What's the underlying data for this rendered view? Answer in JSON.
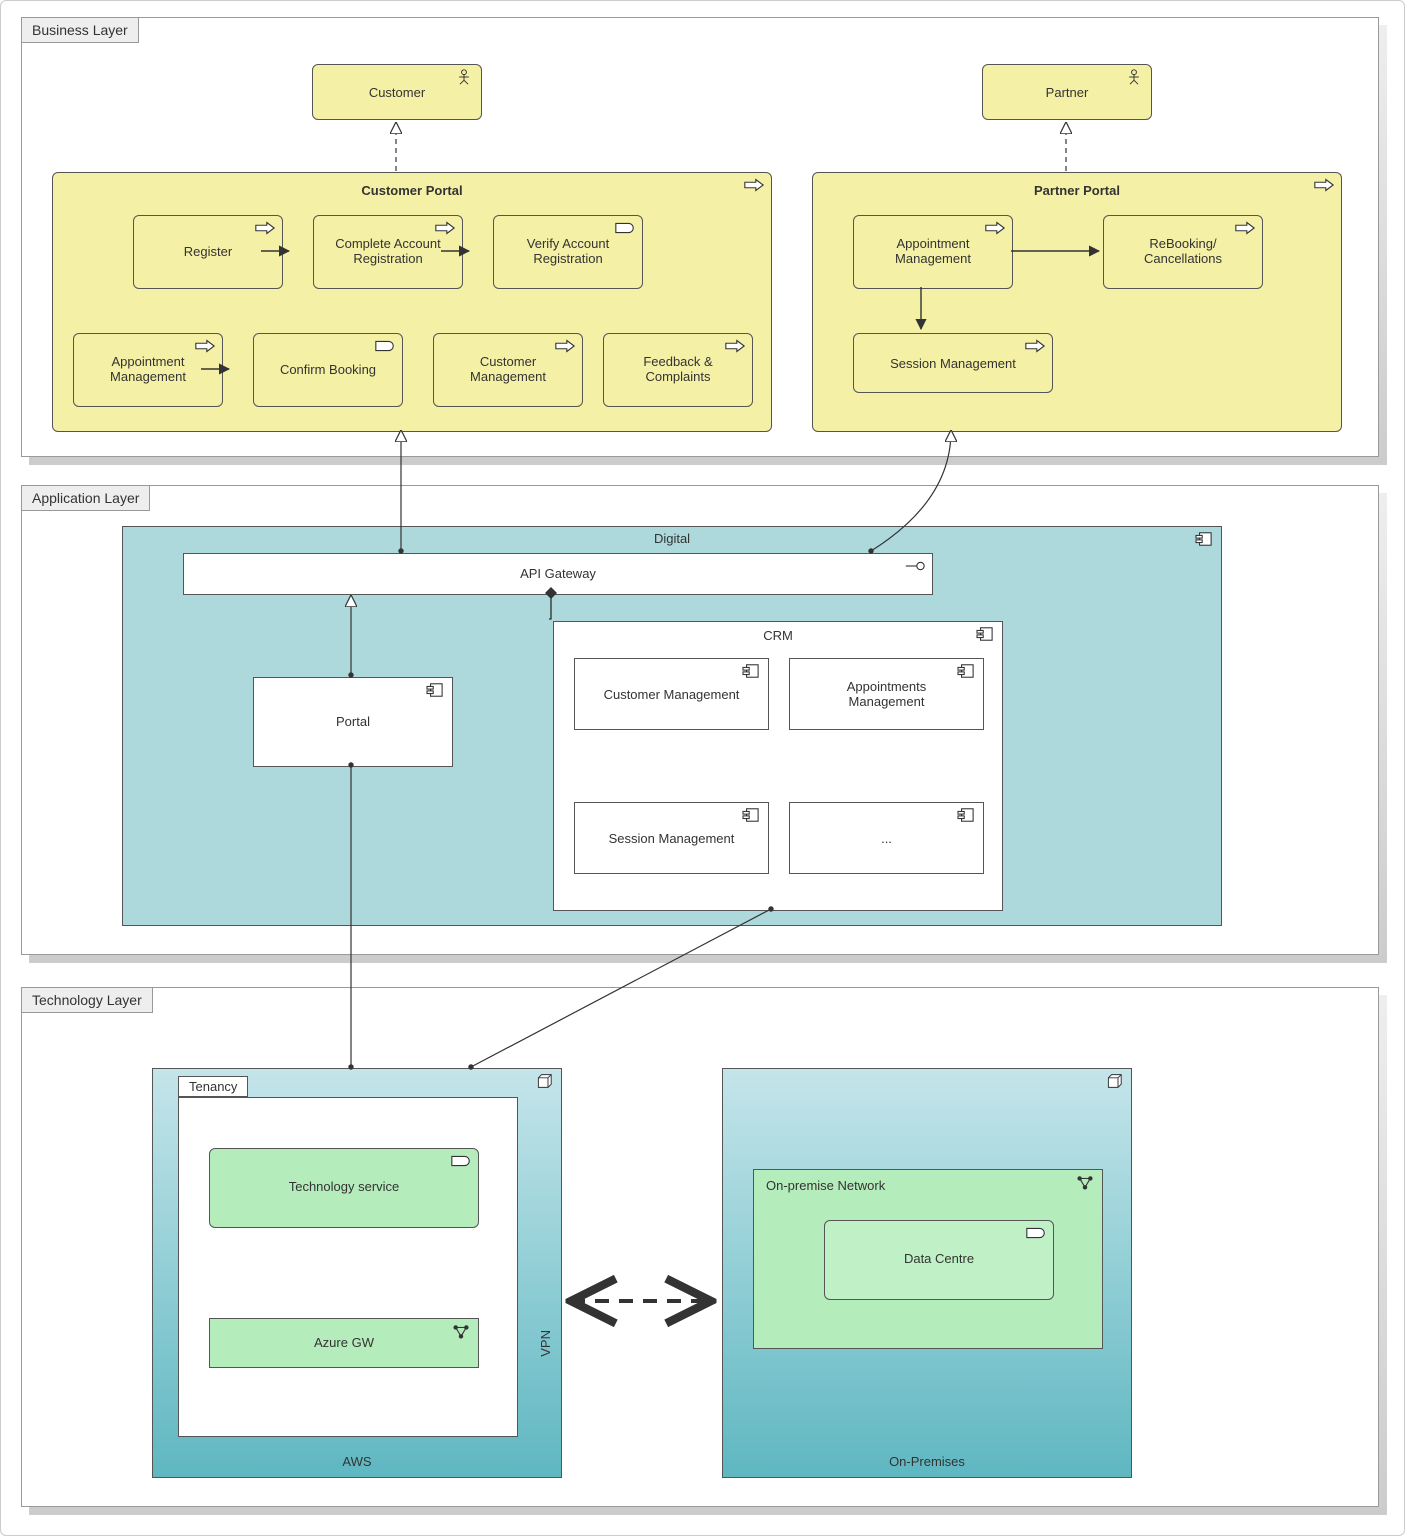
{
  "layers": {
    "business": {
      "title": "Business Layer"
    },
    "application": {
      "title": "Application Layer"
    },
    "technology": {
      "title": "Technology Layer"
    }
  },
  "business": {
    "customer_actor": "Customer",
    "partner_actor": "Partner",
    "customer_portal": {
      "title": "Customer Portal",
      "register": "Register",
      "complete": "Complete Account\nRegistration",
      "verify": "Verify Account\nRegistration",
      "appt_mgmt": "Appointment\nManagement",
      "confirm": "Confirm Booking",
      "cust_mgmt": "Customer\nManagement",
      "feedback": "Feedback &\nComplaints"
    },
    "partner_portal": {
      "title": "Partner Portal",
      "appt_mgmt": "Appointment\nManagement",
      "rebook": "ReBooking/\nCancellations",
      "session": "Session Management"
    }
  },
  "application": {
    "digital": "Digital",
    "api_gw": "API Gateway",
    "portal": "Portal",
    "crm": {
      "title": "CRM",
      "cust_mgmt": "Customer Management",
      "appt_mgmt": "Appointments\nManagement",
      "session": "Session Management",
      "more": "..."
    }
  },
  "technology": {
    "aws": {
      "title": "AWS",
      "tenancy": "Tenancy",
      "tech_service": "Technology service",
      "azure_gw": "Azure GW",
      "vpn": "VPN"
    },
    "onprem": {
      "title": "On-Premises",
      "network": "On-premise Network",
      "dc": "Data Centre"
    }
  }
}
